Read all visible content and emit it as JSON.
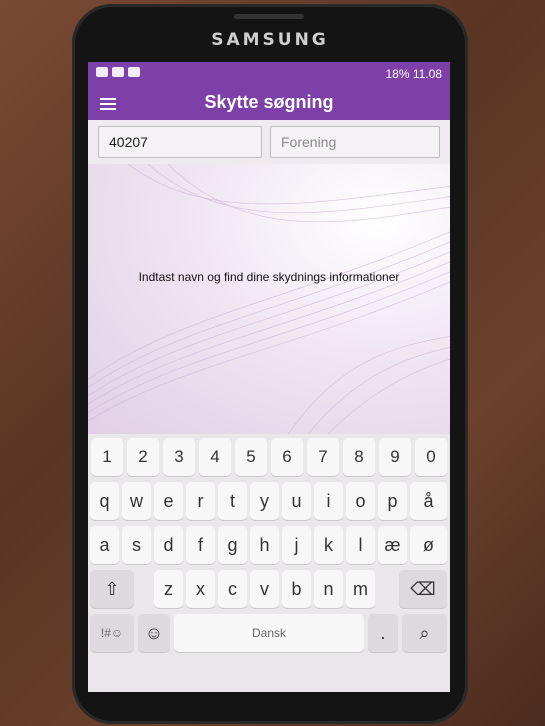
{
  "device": {
    "brand": "SAMSUNG"
  },
  "status_bar": {
    "right_text": "18% 11.08"
  },
  "app_bar": {
    "title": "Skytte søgning",
    "menu_icon": "hamburger-menu-icon"
  },
  "search": {
    "number_value": "40207",
    "club_placeholder": "Forening"
  },
  "content": {
    "message": "Indtast navn og find dine skydnings informationer"
  },
  "keyboard": {
    "row1": [
      "1",
      "2",
      "3",
      "4",
      "5",
      "6",
      "7",
      "8",
      "9",
      "0"
    ],
    "row2": [
      "q",
      "w",
      "e",
      "r",
      "t",
      "y",
      "u",
      "i",
      "o",
      "p",
      "å"
    ],
    "row3": [
      "a",
      "s",
      "d",
      "f",
      "g",
      "h",
      "j",
      "k",
      "l",
      "æ",
      "ø"
    ],
    "row4": [
      "z",
      "x",
      "c",
      "v",
      "b",
      "n",
      "m"
    ],
    "symbols_label": "!#☺",
    "emoji_label": "☺",
    "space_label": "Dansk",
    "period_label": ".",
    "shift_label": "⇧",
    "backspace_label": "⌫",
    "search_label": "⌕"
  }
}
